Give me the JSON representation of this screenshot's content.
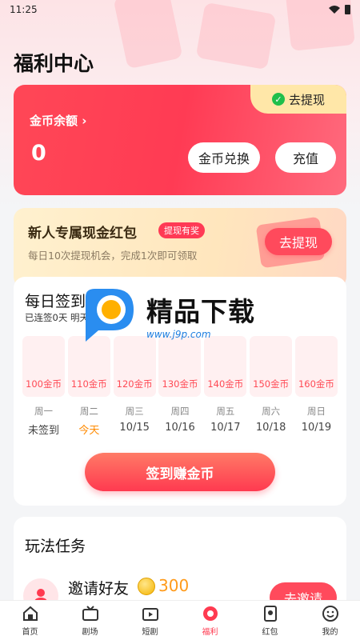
{
  "status_bar": {
    "time": "11:25"
  },
  "page_title": "福利中心",
  "balance_card": {
    "tag_label": "去提现",
    "label": "金币余额 ›",
    "value": "0",
    "exchange_label": "金币兑换",
    "recharge_label": "充值"
  },
  "newbie_card": {
    "title": "新人专属现金红包",
    "badge": "提现有奖",
    "subtitle": "每日10次提现机会，完成1次即可领取",
    "button_label": "去提现"
  },
  "signin": {
    "title": "每日签到",
    "subtitle": "已连签0天 明天继续签到",
    "days": [
      {
        "reward": "100金币",
        "weekday": "周一",
        "date": "未签到",
        "today": false
      },
      {
        "reward": "110金币",
        "weekday": "周二",
        "date": "今天",
        "today": true
      },
      {
        "reward": "120金币",
        "weekday": "周三",
        "date": "10/15",
        "today": false
      },
      {
        "reward": "130金币",
        "weekday": "周四",
        "date": "10/16",
        "today": false
      },
      {
        "reward": "140金币",
        "weekday": "周五",
        "date": "10/17",
        "today": false
      },
      {
        "reward": "150金币",
        "weekday": "周六",
        "date": "10/18",
        "today": false
      },
      {
        "reward": "160金币",
        "weekday": "周日",
        "date": "10/19",
        "today": false
      }
    ],
    "button_label": "签到赚金币"
  },
  "watermark": {
    "main": "精品下载",
    "url": "www.j9p.com"
  },
  "tasks": {
    "title": "玩法任务",
    "items": [
      {
        "name": "邀请好友",
        "reward": "300",
        "button_label": "去邀请",
        "icon": "invite-icon"
      }
    ]
  },
  "tabbar": {
    "items": [
      {
        "label": "首页",
        "icon": "home-icon",
        "active": false
      },
      {
        "label": "剧场",
        "icon": "theater-icon",
        "active": false
      },
      {
        "label": "短剧",
        "icon": "tv-icon",
        "active": false
      },
      {
        "label": "福利",
        "icon": "gift-icon",
        "active": true
      },
      {
        "label": "红包",
        "icon": "red-packet-icon",
        "active": false
      },
      {
        "label": "我的",
        "icon": "profile-icon",
        "active": false
      }
    ]
  },
  "colors": {
    "brand_red": "#ff3a50",
    "today_orange": "#ff8a00",
    "reward_orange": "#ff9a1a",
    "check_green": "#1fbf4b"
  }
}
